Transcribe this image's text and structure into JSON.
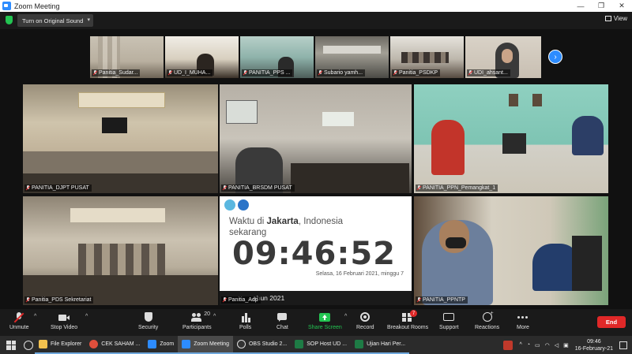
{
  "window": {
    "title": "Zoom Meeting",
    "controls": [
      "—",
      "❐",
      "✕"
    ]
  },
  "topbar": {
    "sound_button": "Turn on Original Sound",
    "view_button": "View"
  },
  "thumbnails": [
    {
      "name": "Panitia_Sudar..."
    },
    {
      "name": "UD_I_MUHA..."
    },
    {
      "name": "PANITIA_PPS ..."
    },
    {
      "name": "Subario yamh..."
    },
    {
      "name": "Panitia_PSDKP"
    },
    {
      "name": "UDI_ahsant..."
    }
  ],
  "tiles": [
    {
      "name": "PANITIA_DJPT PUSAT"
    },
    {
      "name": "PANITIA_BRSDM PUSAT"
    },
    {
      "name": "PANITIA_PPN_Pemangkat_1"
    },
    {
      "name": "Panitia_PDS Sekretariat"
    },
    {
      "name": "Panitia_Adp"
    },
    {
      "name": "PANITIA_PPNTP"
    }
  ],
  "clock": {
    "prefix": "Waktu di ",
    "city": "Jakarta",
    "suffix": ", Indonesia",
    "now": "sekarang",
    "time": "09:46:52",
    "date": "Selasa, 16 Februari 2021, minggu 7",
    "year_strip": "ahun 2021"
  },
  "toolbar": {
    "items": [
      {
        "label": "Unmute",
        "icon": "mic-muted-icon"
      },
      {
        "label": "Stop Video",
        "icon": "video-icon"
      },
      {
        "label": "Security",
        "icon": "shield-icon"
      },
      {
        "label": "Participants",
        "icon": "participants-icon",
        "count": "20"
      },
      {
        "label": "Polls",
        "icon": "polls-icon"
      },
      {
        "label": "Chat",
        "icon": "chat-icon"
      },
      {
        "label": "Share Screen",
        "icon": "share-icon"
      },
      {
        "label": "Record",
        "icon": "record-icon"
      },
      {
        "label": "Breakout Rooms",
        "icon": "breakout-icon",
        "badge": "7"
      },
      {
        "label": "Support",
        "icon": "support-icon"
      },
      {
        "label": "Reactions",
        "icon": "reactions-icon"
      },
      {
        "label": "More",
        "icon": "more-icon"
      }
    ],
    "end_label": "End",
    "share_color": "#23c552",
    "end_color": "#e02828"
  },
  "taskbar": {
    "apps": [
      {
        "label": "File Explorer",
        "color": "#f2c14e"
      },
      {
        "label": "CEK SAHAM ...",
        "color": "#e04f3c"
      },
      {
        "label": "Zoom",
        "color": "#2d8cff"
      },
      {
        "label": "Zoom Meeting",
        "color": "#2d8cff"
      },
      {
        "label": "OBS Studio 2...",
        "color": "#333333"
      },
      {
        "label": "SOP Host UD ...",
        "color": "#1e7b45"
      },
      {
        "label": "Ujian Hari Per...",
        "color": "#1e7b45"
      }
    ],
    "time": "09:46",
    "date": "16-February-21"
  }
}
